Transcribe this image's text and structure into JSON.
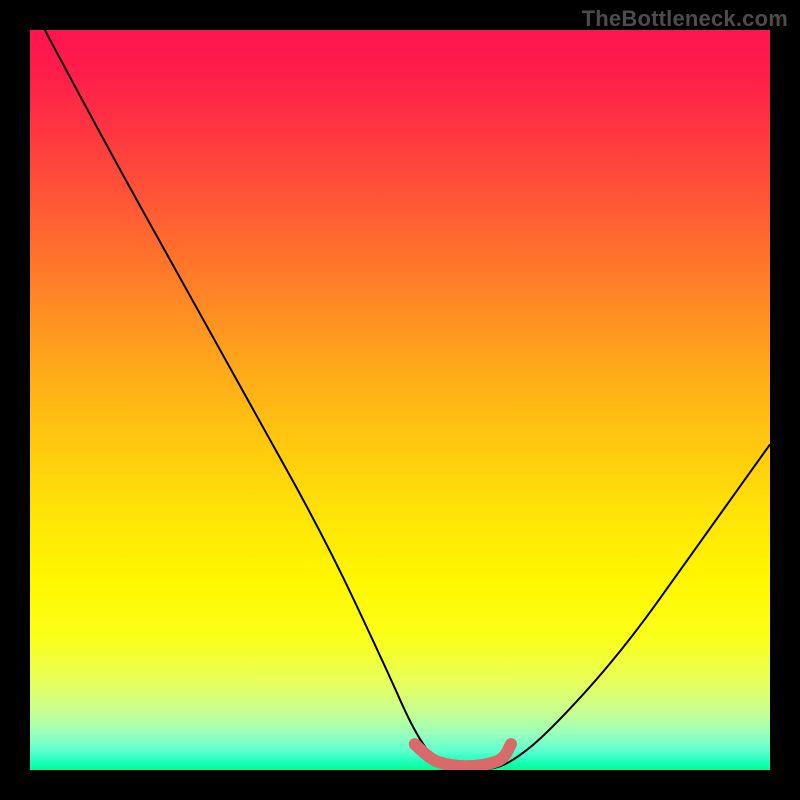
{
  "watermark": "TheBottleneck.com",
  "chart_data": {
    "type": "line",
    "title": "",
    "xlabel": "",
    "ylabel": "",
    "xlim": [
      0,
      100
    ],
    "ylim": [
      0,
      100
    ],
    "series": [
      {
        "name": "bottleneck-curve",
        "x": [
          2,
          10,
          20,
          30,
          40,
          48,
          52,
          55,
          58,
          62,
          65,
          70,
          80,
          90,
          100
        ],
        "y": [
          100,
          85,
          67,
          49,
          31,
          14,
          5,
          1,
          0,
          0,
          1,
          5,
          16,
          30,
          44
        ]
      },
      {
        "name": "optimal-range-marker",
        "x": [
          52,
          54,
          56,
          58,
          60,
          62,
          64,
          65
        ],
        "y": [
          3.5,
          1.5,
          0.8,
          0.5,
          0.5,
          0.8,
          1.5,
          3.5
        ]
      }
    ],
    "colors": {
      "curve": "#000000",
      "marker": "#d96a6a",
      "gradient_top": "#ff1450",
      "gradient_bottom": "#00ff90"
    }
  }
}
